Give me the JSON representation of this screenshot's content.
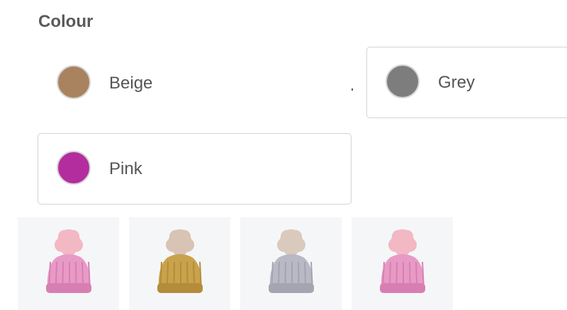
{
  "section": {
    "title": "Colour"
  },
  "colours": [
    {
      "label": "Beige",
      "swatch": "#a9835f",
      "selected": false
    },
    {
      "label": "Grey",
      "swatch": "#7d7d7d",
      "selected": true
    },
    {
      "label": "Pink",
      "swatch": "#b32d9e",
      "selected": true
    }
  ],
  "thumbnails": [
    {
      "icon": "pink-bobble-hat-icon",
      "hat": "#e89ac6",
      "ribbing": "#d77fb2",
      "pompom": "#f2b8c4"
    },
    {
      "icon": "mustard-bobble-hat-icon",
      "hat": "#c9a24c",
      "ribbing": "#b48c3a",
      "pompom": "#d8c4b4"
    },
    {
      "icon": "grey-bobble-hat-icon",
      "hat": "#b8b9c4",
      "ribbing": "#a4a5b1",
      "pompom": "#d9cabd"
    },
    {
      "icon": "pink-bobble-hat-icon",
      "hat": "#e89ac6",
      "ribbing": "#d77fb2",
      "pompom": "#f2b8c4"
    }
  ]
}
